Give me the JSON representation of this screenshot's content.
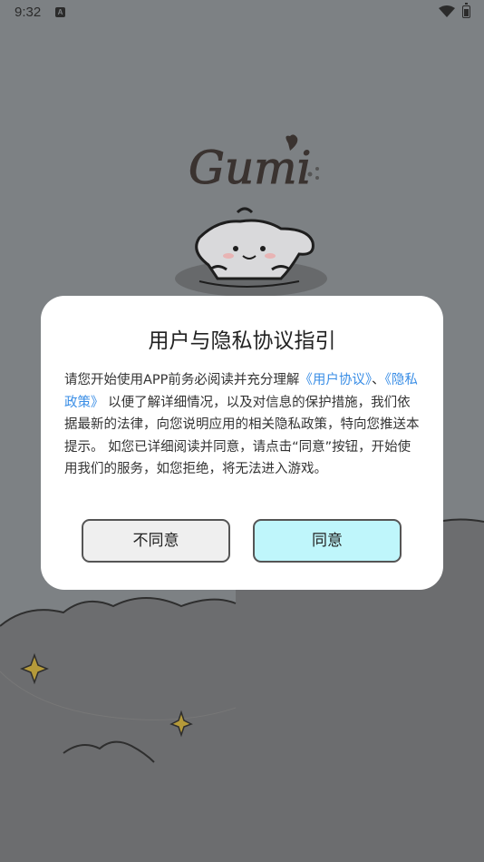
{
  "status_bar": {
    "time": "9:32",
    "notification_icon": "A",
    "wifi_icon": "wifi-icon",
    "battery_icon": "battery-icon"
  },
  "splash": {
    "logo_text": "Gumi",
    "mascot_icon": "dog-mascot-icon"
  },
  "dialog": {
    "title": "用户与隐私协议指引",
    "body_prefix": "请您开始使用APP前务必阅读并充分理解",
    "link_user_agreement": "《用户协议》",
    "separator": "、",
    "link_privacy_policy": "《隐私政策》",
    "body_suffix": "以便了解详细情况，以及对信息的保护措施，我们依据最新的法律，向您说明应用的相关隐私政策，特向您推送本提示。 如您已详细阅读并同意，请点击“同意”按钮，开始使用我们的服务，如您拒绝，将无法进入游戏。",
    "disagree_label": "不同意",
    "agree_label": "同意"
  },
  "colors": {
    "background": "#7d8184",
    "dialog": "#ffffff",
    "link": "#3a8ee6",
    "agree_button": "#bff6fb",
    "disagree_button": "#efefef"
  }
}
